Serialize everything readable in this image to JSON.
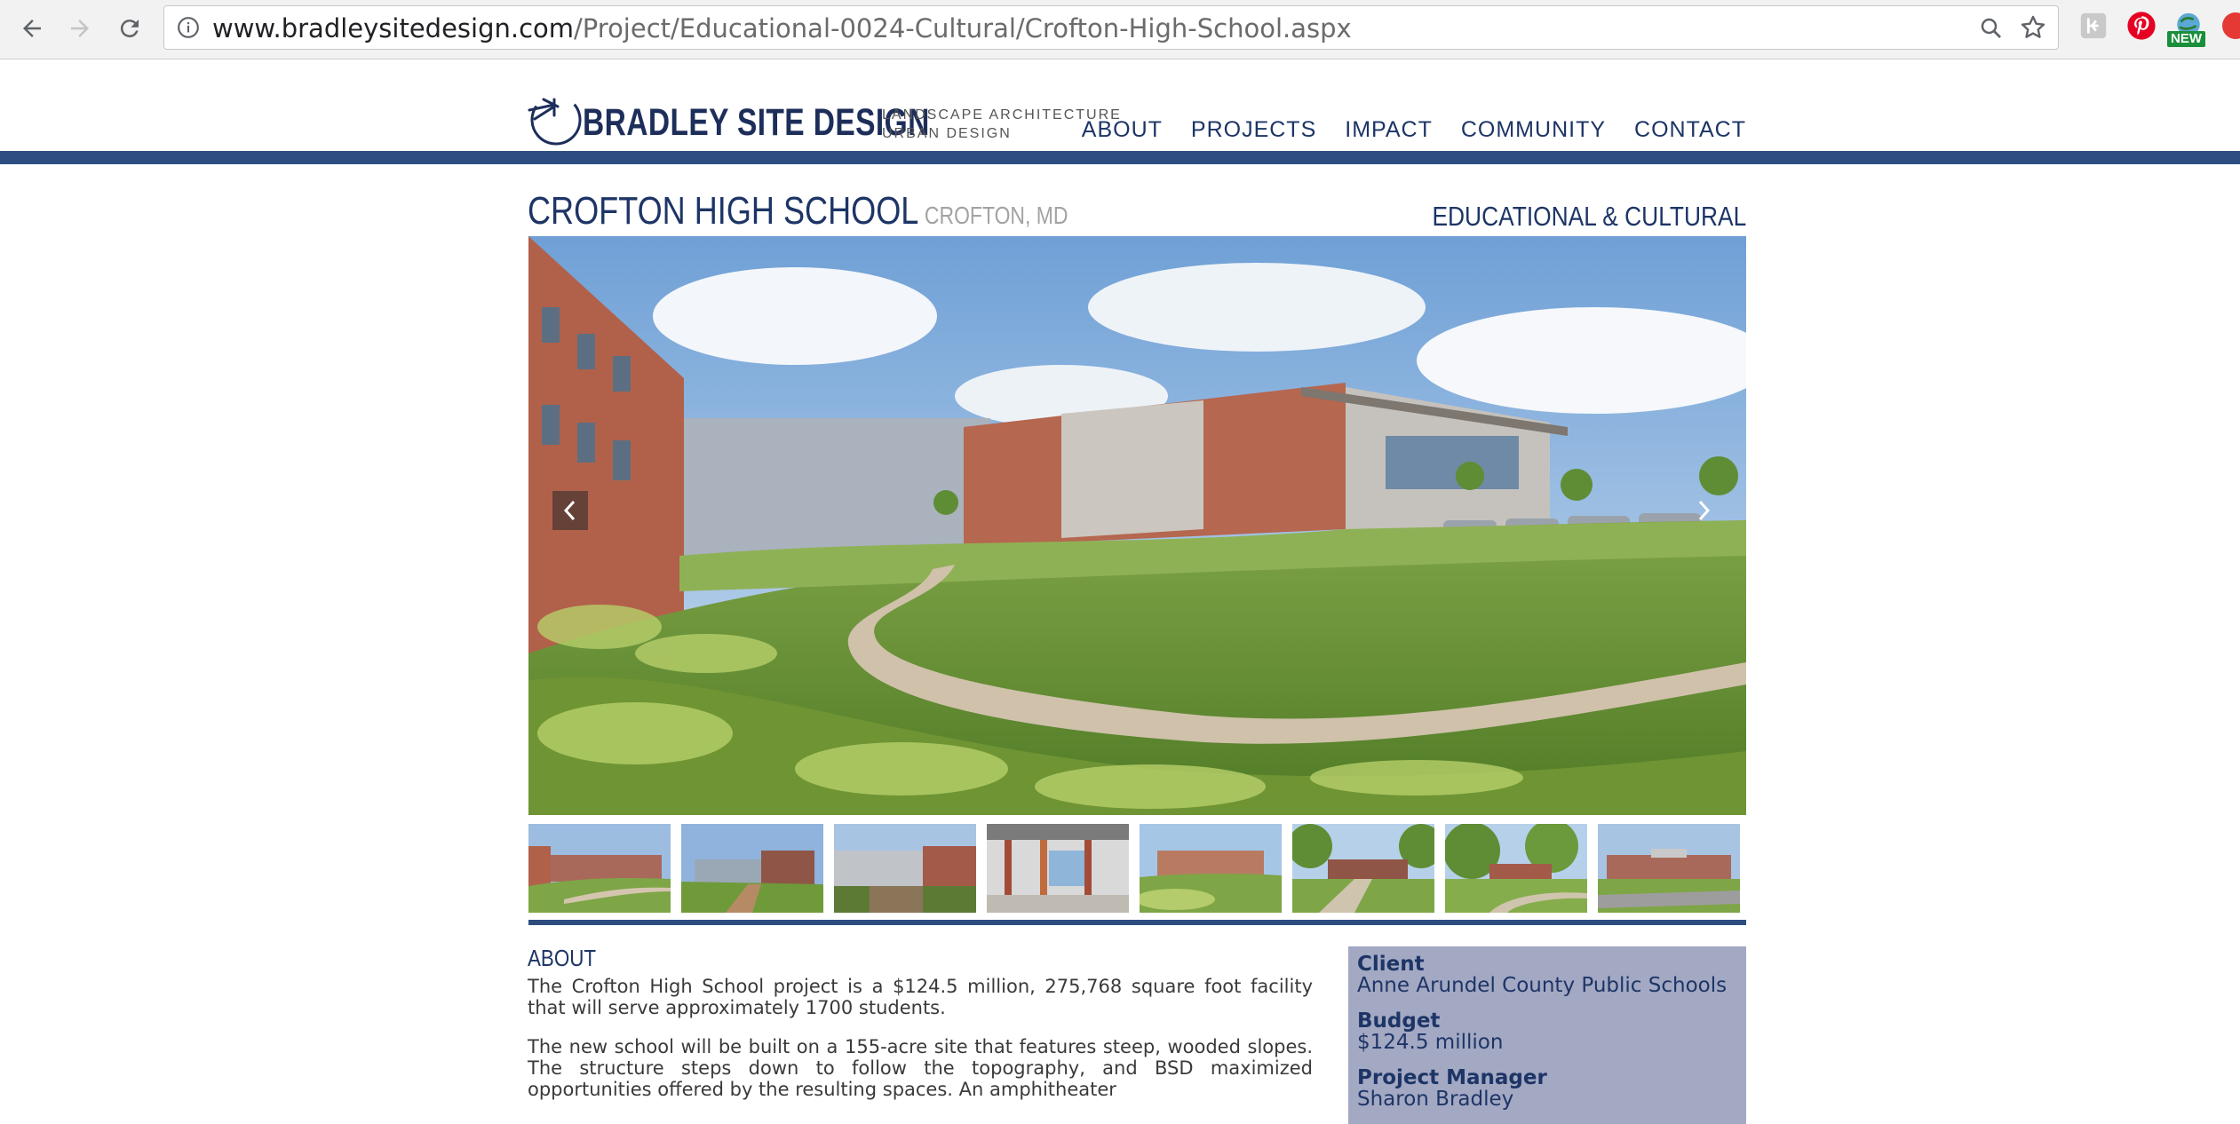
{
  "browser": {
    "url_domain": "www.bradleysitedesign.com",
    "url_path": "/Project/Educational-0024-Cultural/Crofton-High-School.aspx",
    "extension_badge": "NEW",
    "icons": [
      "back-icon",
      "forward-icon",
      "reload-icon",
      "info-icon",
      "zoom-icon",
      "star-icon",
      "extension-icon",
      "pinterest-icon",
      "extension-new-icon"
    ]
  },
  "site": {
    "logo_text": "BRADLEY SITE DESIGN",
    "logo_sub_1": "LANDSCAPE ARCHITECTURE",
    "logo_sub_2": "URBAN DESIGN",
    "nav": [
      "ABOUT",
      "PROJECTS",
      "IMPACT",
      "COMMUNITY",
      "CONTACT"
    ],
    "accent_color": "#2d4d80",
    "text_color": "#1d3566"
  },
  "project": {
    "title": "CROFTON HIGH SCHOOL",
    "location": "CROFTON, MD",
    "category": "EDUCATIONAL & CULTURAL",
    "thumbnail_count": 8
  },
  "about": {
    "heading": "ABOUT",
    "paragraph_1": "The Crofton High School project is a $124.5 million, 275,768 square foot facility that will serve approximately 1700 students.",
    "paragraph_2": "The new school will be built on a 155-acre site that features steep, wooded slopes. The structure steps down to follow the topography, and BSD maximized opportunities offered by the resulting spaces. An amphitheater"
  },
  "info": {
    "client_label": "Client",
    "client_value": "Anne Arundel County Public Schools",
    "budget_label": "Budget",
    "budget_value": "$124.5 million",
    "pm_label": "Project Manager",
    "pm_value": "Sharon Bradley",
    "box_color": "#a3a8c3"
  }
}
